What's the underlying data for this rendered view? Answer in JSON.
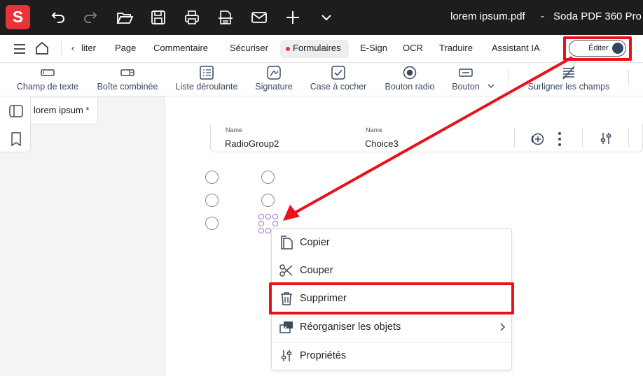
{
  "app": {
    "logo_letter": "S",
    "file_name": "lorem ipsum.pdf",
    "separator": "-",
    "app_name": "Soda PDF 360 Pro"
  },
  "titlebar_icons": [
    "undo-icon",
    "redo-icon",
    "open-folder-icon",
    "save-icon",
    "print-icon",
    "scan-icon",
    "mail-icon",
    "plus-icon",
    "chevron-down-icon"
  ],
  "menubar": {
    "items": [
      "‹",
      "liter",
      "Page",
      "Commentaire",
      "Sécuriser",
      "Formulaires",
      "E-Sign",
      "OCR",
      "Traduire",
      "Assistant IA"
    ],
    "active": "Formulaires",
    "edit_toggle_label": "Éditer"
  },
  "form_tools": [
    {
      "label": "Champ de texte",
      "icon": "text-field-icon"
    },
    {
      "label": "Boîte combinée",
      "icon": "combo-box-icon"
    },
    {
      "label": "Liste déroulante",
      "icon": "list-box-icon"
    },
    {
      "label": "Signature",
      "icon": "signature-icon"
    },
    {
      "label": "Case à cocher",
      "icon": "checkbox-icon"
    },
    {
      "label": "Bouton radio",
      "icon": "radio-button-icon"
    },
    {
      "label": "Bouton",
      "icon": "button-icon"
    },
    {
      "label": "Surligner les champs",
      "icon": "highlight-fields-icon"
    }
  ],
  "doc_tab": {
    "label": "lorem ipsum *"
  },
  "properties": {
    "name_caption": "Name",
    "field1": "RadioGroup2",
    "field2": "Choice3"
  },
  "context_menu": {
    "items": [
      "Copier",
      "Couper",
      "Supprimer",
      "Réorganiser les objets",
      "Propriétés"
    ],
    "highlighted": "Supprimer"
  },
  "colors": {
    "brand_red": "#e8333a",
    "titlebar_bg": "#1d1d1f",
    "annotation_red": "#e8121b",
    "toolbar_text": "#3a4a5f"
  }
}
